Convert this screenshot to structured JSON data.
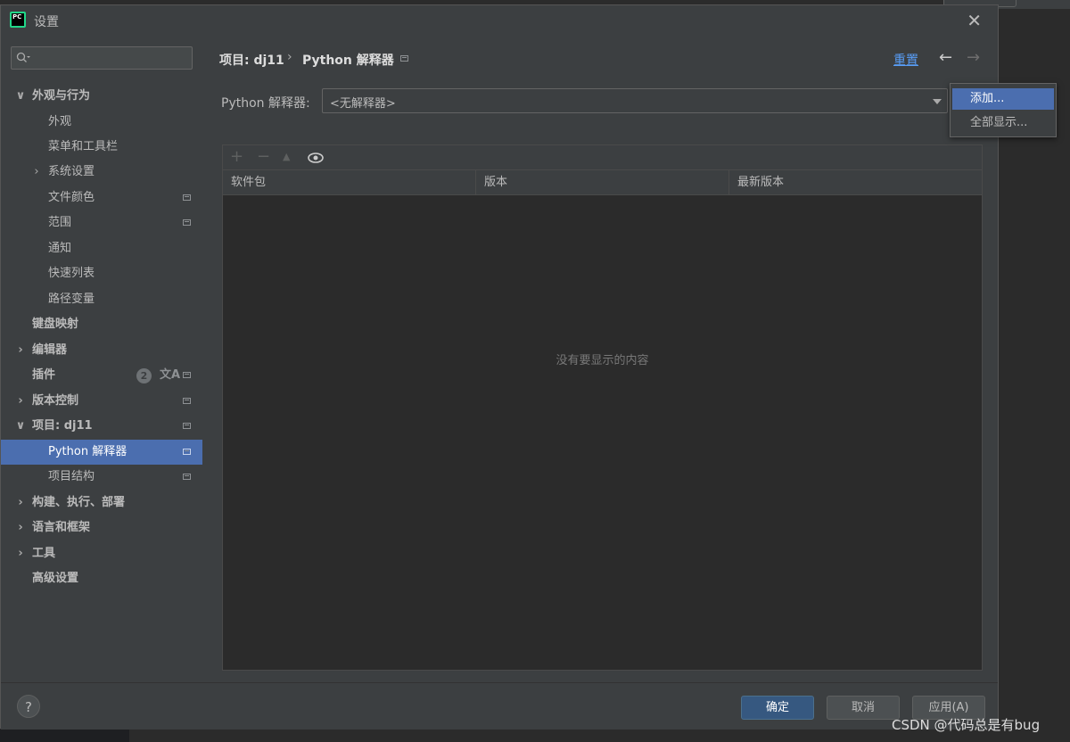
{
  "window": {
    "title": "设置",
    "close_glyph": "✕"
  },
  "search": {
    "placeholder": "",
    "icon": "search-icon"
  },
  "sidebar": {
    "items": [
      {
        "label": "外观与行为",
        "expanded": true
      },
      {
        "label": "外观"
      },
      {
        "label": "菜单和工具栏"
      },
      {
        "label": "系统设置"
      },
      {
        "label": "文件颜色"
      },
      {
        "label": "范围"
      },
      {
        "label": "通知"
      },
      {
        "label": "快速列表"
      },
      {
        "label": "路径变量"
      },
      {
        "label": "键盘映射"
      },
      {
        "label": "编辑器"
      },
      {
        "label": "插件",
        "badge": "2"
      },
      {
        "label": "版本控制"
      },
      {
        "label": "项目: dj11",
        "expanded": true
      },
      {
        "label": "Python 解释器",
        "selected": true
      },
      {
        "label": "项目结构"
      },
      {
        "label": "构建、执行、部署"
      },
      {
        "label": "语言和框架"
      },
      {
        "label": "工具"
      },
      {
        "label": "高级设置"
      }
    ]
  },
  "breadcrumb": {
    "project": "项目: dj11",
    "separator": "›",
    "page": "Python 解释器"
  },
  "header": {
    "reset_label": "重置",
    "back_glyph": "←",
    "forward_glyph": "→"
  },
  "interpreter": {
    "label": "Python 解释器:",
    "value": "<无解释器>"
  },
  "dropdown": {
    "items": [
      "添加...",
      "全部显示..."
    ]
  },
  "toolbar": {
    "add": "+",
    "remove": "−",
    "up": "▲",
    "eye": "👁"
  },
  "table": {
    "columns": [
      "软件包",
      "版本",
      "最新版本"
    ],
    "empty_text": "没有要显示的内容"
  },
  "footer": {
    "help": "?",
    "ok": "确定",
    "cancel": "取消",
    "apply": "应用(A)"
  },
  "watermark": "CSDN @代码总是有bug",
  "colors": {
    "selection": "#4b6eaf",
    "link": "#589df6",
    "primary_button": "#365880",
    "background": "#3c3f41"
  }
}
